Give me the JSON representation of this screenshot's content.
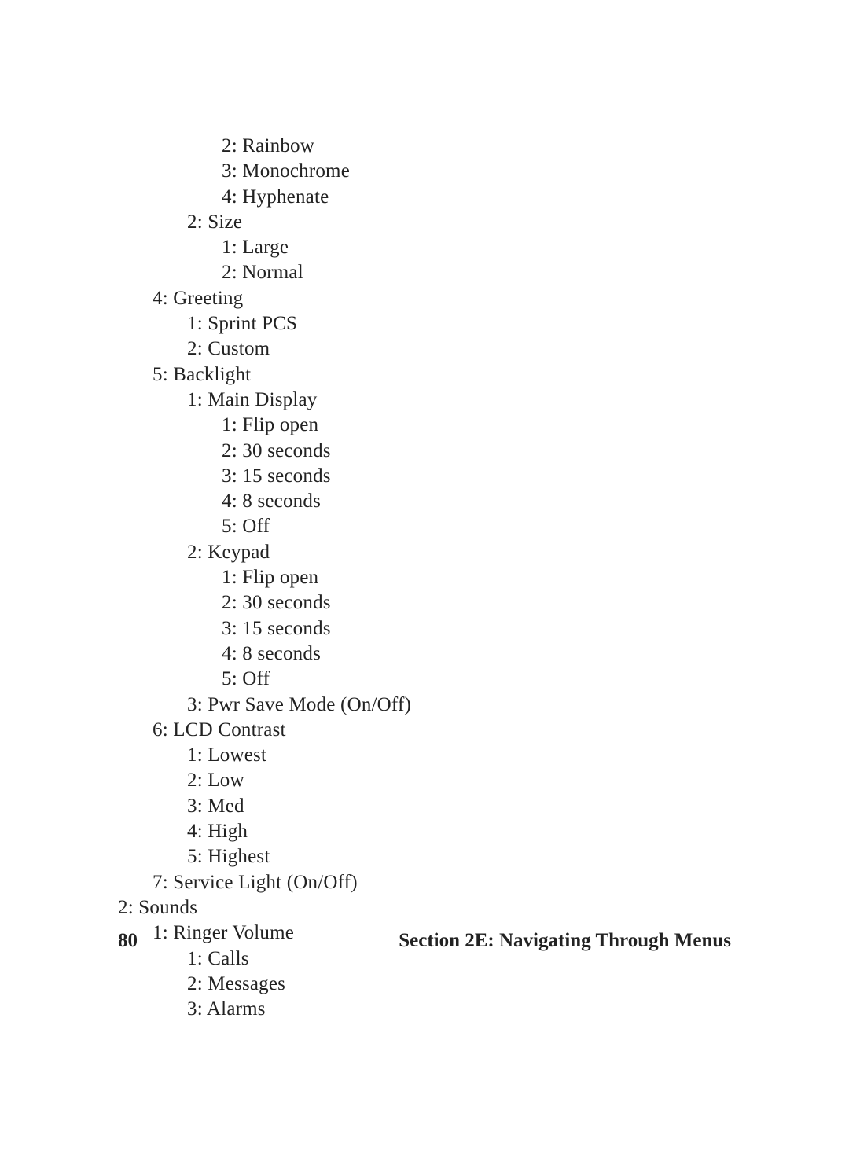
{
  "footer": {
    "page": "80",
    "section": "Section 2E: Navigating Through Menus"
  },
  "lines": [
    {
      "indent": "i3",
      "text": "2: Rainbow"
    },
    {
      "indent": "i3",
      "text": "3: Monochrome"
    },
    {
      "indent": "i3",
      "text": "4: Hyphenate"
    },
    {
      "indent": "i2",
      "text": "2: Size"
    },
    {
      "indent": "i3",
      "text": "1: Large"
    },
    {
      "indent": "i3",
      "text": "2: Normal"
    },
    {
      "indent": "i1",
      "text": "4: Greeting"
    },
    {
      "indent": "i2",
      "text": "1: Sprint PCS"
    },
    {
      "indent": "i2",
      "text": "2: Custom"
    },
    {
      "indent": "i1",
      "text": "5: Backlight"
    },
    {
      "indent": "i2",
      "text": "1: Main Display"
    },
    {
      "indent": "i3",
      "text": "1: Flip open"
    },
    {
      "indent": "i3",
      "text": "2: 30 seconds"
    },
    {
      "indent": "i3",
      "text": "3: 15 seconds"
    },
    {
      "indent": "i3",
      "text": "4: 8 seconds"
    },
    {
      "indent": "i3",
      "text": "5: Off"
    },
    {
      "indent": "i2",
      "text": "2: Keypad"
    },
    {
      "indent": "i3",
      "text": "1: Flip open"
    },
    {
      "indent": "i3",
      "text": "2: 30 seconds"
    },
    {
      "indent": "i3",
      "text": "3: 15 seconds"
    },
    {
      "indent": "i3",
      "text": "4: 8 seconds"
    },
    {
      "indent": "i3",
      "text": "5: Off"
    },
    {
      "indent": "i2",
      "text": "3: Pwr Save Mode (On/Off)"
    },
    {
      "indent": "i1",
      "text": "6: LCD Contrast"
    },
    {
      "indent": "i2",
      "text": "1: Lowest"
    },
    {
      "indent": "i2",
      "text": "2: Low"
    },
    {
      "indent": "i2",
      "text": "3: Med"
    },
    {
      "indent": "i2",
      "text": "4: High"
    },
    {
      "indent": "i2",
      "text": "5: Highest"
    },
    {
      "indent": "i1",
      "text": "7: Service Light (On/Off)"
    },
    {
      "indent": "i0",
      "text": "2: Sounds"
    },
    {
      "indent": "i1",
      "text": "1: Ringer Volume"
    },
    {
      "indent": "i2",
      "text": "1: Calls"
    },
    {
      "indent": "i2",
      "text": "2: Messages"
    },
    {
      "indent": "i2",
      "text": "3: Alarms"
    }
  ]
}
